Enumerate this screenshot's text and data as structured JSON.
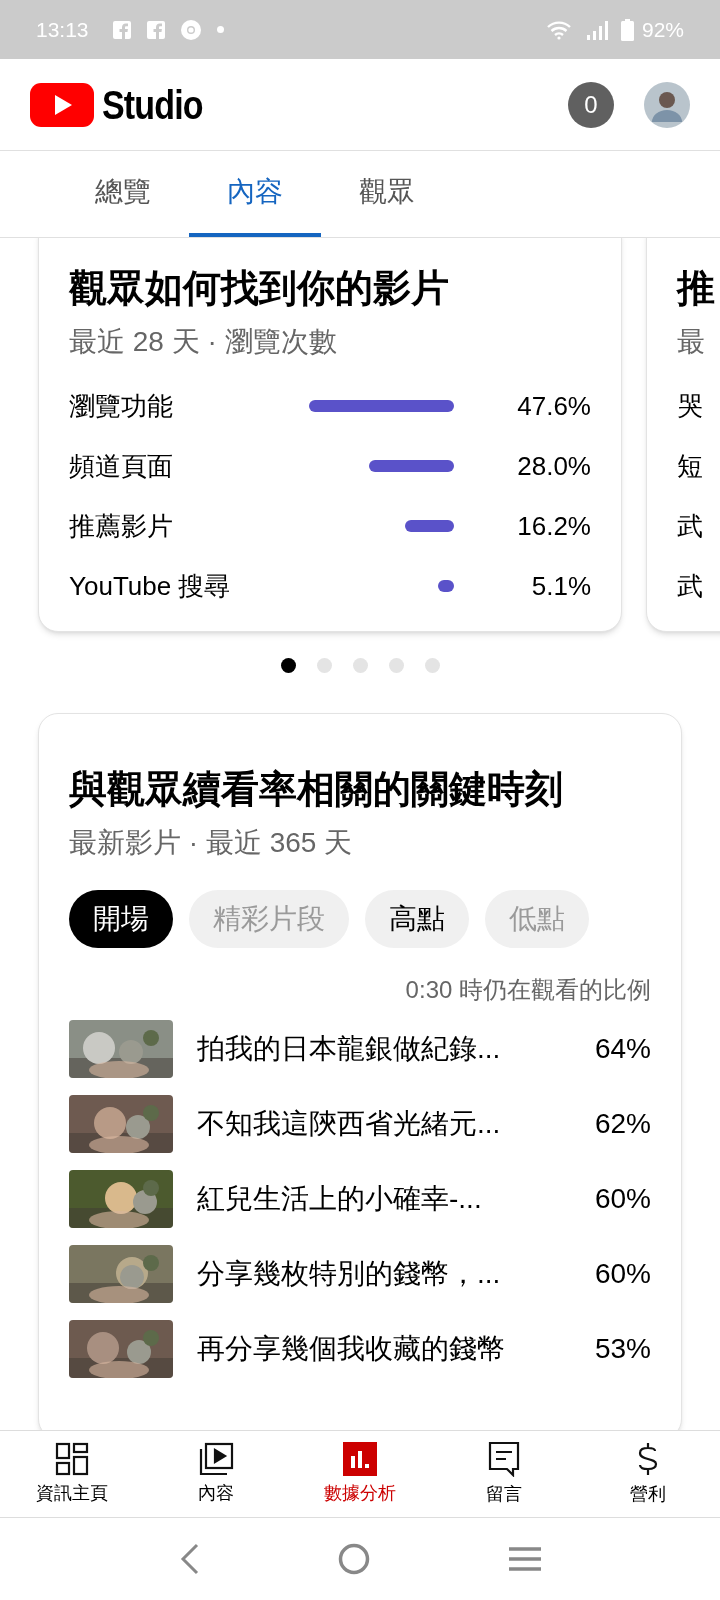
{
  "status_bar": {
    "time": "13:13",
    "battery": "92%"
  },
  "header": {
    "logo_text": "Studio",
    "notifications": "0"
  },
  "tabs": [
    {
      "label": "總覽",
      "selected": false
    },
    {
      "label": "內容",
      "selected": true
    },
    {
      "label": "觀眾",
      "selected": false
    }
  ],
  "traffic_card": {
    "title": "觀眾如何找到你的影片",
    "subtitle": "最近 28 天 · 瀏覽次數",
    "rows": [
      {
        "label": "瀏覽功能",
        "value": "47.6%"
      },
      {
        "label": "頻道頁面",
        "value": "28.0%"
      },
      {
        "label": "推薦影片",
        "value": "16.2%"
      },
      {
        "label": "YouTube 搜尋",
        "value": "5.1%"
      }
    ]
  },
  "next_card": {
    "title": "推",
    "subtitle": "最",
    "rows": [
      "哭",
      "短",
      "武",
      "武"
    ]
  },
  "pager": [
    {
      "selected": true
    },
    {
      "selected": false
    },
    {
      "selected": false
    },
    {
      "selected": false
    },
    {
      "selected": false
    }
  ],
  "moments_card": {
    "title": "與觀眾續看率相關的關鍵時刻",
    "subtitle": "最新影片 · 最近 365 天",
    "chips": [
      {
        "label": "開場",
        "selected": true,
        "disabled": false
      },
      {
        "label": "精彩片段",
        "selected": false,
        "disabled": true
      },
      {
        "label": "高點",
        "selected": false,
        "disabled": false
      },
      {
        "label": "低點",
        "selected": false,
        "disabled": true
      }
    ],
    "column_label": "0:30 時仍在觀看的比例",
    "videos": [
      {
        "title": "拍我的日本龍銀做紀錄...",
        "value": "64%"
      },
      {
        "title": "不知我這陝西省光緒元...",
        "value": "62%"
      },
      {
        "title": "紅兒生活上的小確幸-...",
        "value": "60%"
      },
      {
        "title": "分享幾枚特別的錢幣，...",
        "value": "60%"
      },
      {
        "title": "再分享幾個我收藏的錢幣",
        "value": "53%"
      }
    ]
  },
  "bottom_nav": [
    {
      "kind": "dashboard",
      "label": "資訊主頁",
      "selected": false
    },
    {
      "kind": "content",
      "label": "內容",
      "selected": false
    },
    {
      "kind": "analytics",
      "label": "數據分析",
      "selected": true
    },
    {
      "kind": "comments",
      "label": "留言",
      "selected": false
    },
    {
      "kind": "earn",
      "label": "營利",
      "selected": false
    }
  ]
}
